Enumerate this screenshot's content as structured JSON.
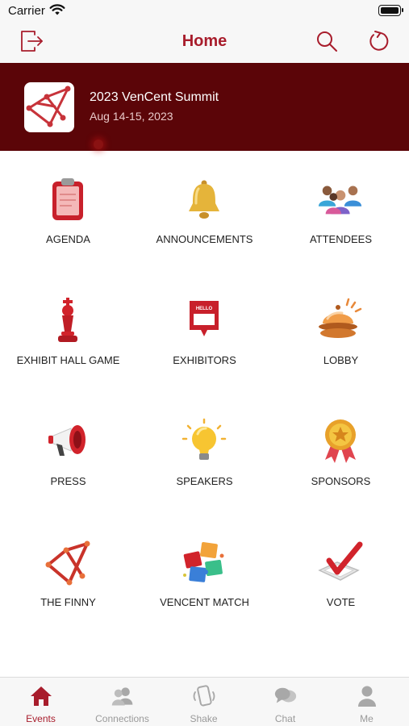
{
  "status_bar": {
    "carrier": "Carrier"
  },
  "header": {
    "title": "Home"
  },
  "event": {
    "name": "2023 VenCent Summit",
    "dates": "Aug 14-15, 2023"
  },
  "tiles": [
    {
      "label": "AGENDA",
      "icon": "clipboard-icon"
    },
    {
      "label": "ANNOUNCEMENTS",
      "icon": "bell-icon"
    },
    {
      "label": "ATTENDEES",
      "icon": "people-icon"
    },
    {
      "label": "EXHIBIT HALL GAME",
      "icon": "chess-king-icon"
    },
    {
      "label": "EXHIBITORS",
      "icon": "hello-badge-icon"
    },
    {
      "label": "LOBBY",
      "icon": "service-bell-icon"
    },
    {
      "label": "PRESS",
      "icon": "megaphone-icon"
    },
    {
      "label": "SPEAKERS",
      "icon": "lightbulb-icon"
    },
    {
      "label": "SPONSORS",
      "icon": "award-medal-icon"
    },
    {
      "label": "THE FINNY",
      "icon": "network-logo-icon"
    },
    {
      "label": "VENCENT MATCH",
      "icon": "puzzle-icon"
    },
    {
      "label": "VOTE",
      "icon": "checkmark-box-icon"
    }
  ],
  "tabs": [
    {
      "label": "Events",
      "icon": "house-icon",
      "active": true
    },
    {
      "label": "Connections",
      "icon": "people-icon",
      "active": false
    },
    {
      "label": "Shake",
      "icon": "phone-shake-icon",
      "active": false
    },
    {
      "label": "Chat",
      "icon": "chat-bubbles-icon",
      "active": false
    },
    {
      "label": "Me",
      "icon": "person-icon",
      "active": false
    }
  ],
  "colors": {
    "brand": "#a81d2c",
    "banner": "#5b0508",
    "tab_inactive": "#9a9a9a",
    "bar_background": "#f7f7f7"
  }
}
